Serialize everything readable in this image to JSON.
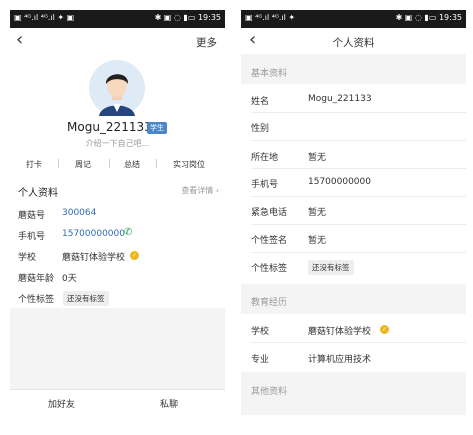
{
  "left": {
    "status": {
      "left": "▣ ⁴ᴳ.ıl ⁴ᴳ.ıl ✦ ▣",
      "right": "✱ ▣ ◌ ▮▭ 19:35"
    },
    "nav": {
      "more": "更多"
    },
    "profile": {
      "name": "Mogu_221133",
      "role_badge": "学生",
      "bio": "介绍一下自己吧..."
    },
    "actions": [
      "打卡",
      "周记",
      "总结",
      "实习岗位"
    ],
    "info": {
      "title": "个人资料",
      "detail_link": "查看详情",
      "rows": [
        {
          "label": "蘑菇号",
          "value": "300064"
        },
        {
          "label": "手机号",
          "value": "15700000000"
        },
        {
          "label": "学校",
          "value": "蘑菇钉体验学校"
        },
        {
          "label": "蘑菇年龄",
          "value": "0天"
        },
        {
          "label": "个性标签",
          "value": "还没有标签"
        }
      ]
    },
    "bottom": {
      "add_friend": "加好友",
      "message": "私聊"
    }
  },
  "right": {
    "status": {
      "left": "▣ ⁴ᴳ.ıl ⁴ᴳ.ıl ✦",
      "right": "✱ ▣ ◌ ▮▭ 19:35"
    },
    "nav": {
      "title": "个人资料"
    },
    "basic": {
      "title": "基本资料",
      "rows": [
        {
          "label": "姓名",
          "value": "Mogu_221133"
        },
        {
          "label": "性别",
          "value": ""
        },
        {
          "label": "所在地",
          "value": "暂无"
        },
        {
          "label": "手机号",
          "value": "15700000000"
        },
        {
          "label": "紧急电话",
          "value": "暂无"
        },
        {
          "label": "个性签名",
          "value": "暂无"
        },
        {
          "label": "个性标签",
          "value": "还没有标签"
        }
      ]
    },
    "edu": {
      "title": "教育经历",
      "rows": [
        {
          "label": "学校",
          "value": "蘑菇钉体验学校"
        },
        {
          "label": "专业",
          "value": "计算机应用技术"
        }
      ]
    },
    "other": {
      "title": "其他资料"
    }
  },
  "colors": {
    "accent_blue": "#2f6bb3",
    "gold_badge": "#f1b51c",
    "phone_green": "#2aa84a"
  }
}
